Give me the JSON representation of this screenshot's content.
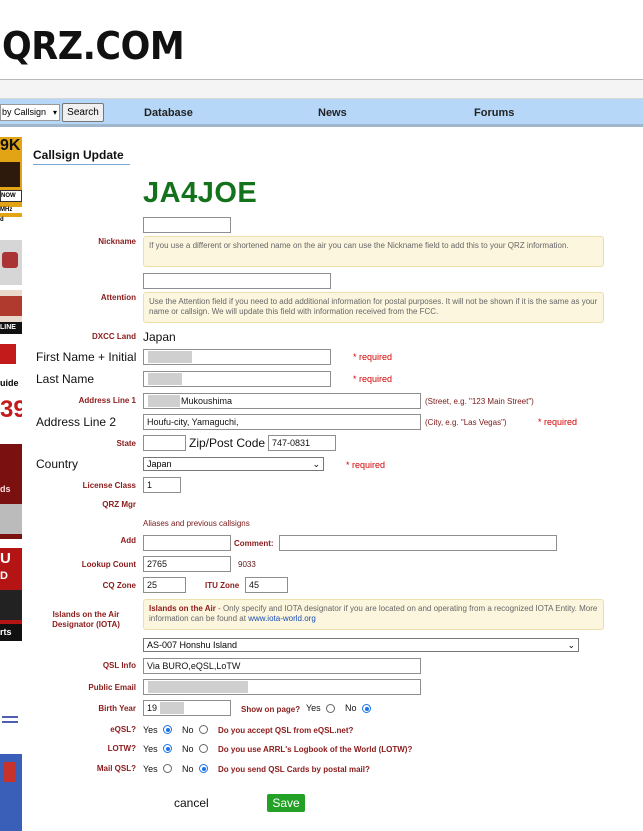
{
  "header": {
    "logo": "QRZ.COM"
  },
  "nav": {
    "search_select": "by Callsign",
    "search_button": "Search",
    "links": [
      "Database",
      "News",
      "Forums"
    ]
  },
  "ads": [
    "9K",
    "NOW",
    "MHz",
    "d",
    "LINE",
    "uide",
    "39",
    "ds",
    "U",
    "D",
    "rts"
  ],
  "page_title": "Callsign Update",
  "callsign": "JA4JOE",
  "fields": {
    "nickname": {
      "label": "Nickname",
      "value": "",
      "note": "If you use a different or shortened name on the air you can use the Nickname field to add this to your QRZ information."
    },
    "attention": {
      "label": "Attention",
      "value": "",
      "note": "Use the Attention field if you need to add additional information for postal purposes. It will not be shown if it is the same as your name or callsign. We will update this field with information received from the FCC."
    },
    "dxcc": {
      "label": "DXCC Land",
      "value": "Japan"
    },
    "first_name": {
      "label": "First Name + Initial",
      "required": "* required"
    },
    "last_name": {
      "label": "Last Name",
      "required": "* required"
    },
    "address1": {
      "label": "Address Line 1",
      "value": "Mukoushima",
      "hint": "(Street, e.g. \"123 Main Street\")"
    },
    "address2": {
      "label": "Address Line 2",
      "value": "Houfu-city, Yamaguchi,",
      "hint": "(City, e.g. \"Las Vegas\")",
      "required": "* required"
    },
    "state": {
      "label": "State",
      "value": ""
    },
    "zip": {
      "label": "Zip/Post Code",
      "value": "747-0831"
    },
    "country": {
      "label": "Country",
      "value": "Japan",
      "required": "* required"
    },
    "license_class": {
      "label": "License Class",
      "value": "1"
    },
    "qrz_mgr": {
      "label": "QRZ Mgr"
    },
    "aliases": {
      "heading": "Aliases and previous callsigns"
    },
    "add": {
      "label": "Add",
      "comment_label": "Comment:"
    },
    "lookup_count": {
      "label": "Lookup Count",
      "value": "2765",
      "extra": "9033"
    },
    "cq_zone": {
      "label": "CQ Zone",
      "value": "25"
    },
    "itu_zone": {
      "label": "ITU Zone",
      "value": "45"
    },
    "iota": {
      "label": "Islands on the Air Designator (IOTA)",
      "note_title": "Islands on the Air",
      "note_body": " - Only specify and IOTA designator if you are located on and operating from a recognized IOTA Entity. More information can be found at ",
      "note_link": "www.iota-world.org",
      "value": "AS-007 Honshu Island"
    },
    "qsl_info": {
      "label": "QSL Info",
      "value": "Via BURO,eQSL,LoTW"
    },
    "public_email": {
      "label": "Public Email",
      "value": ""
    },
    "birth_year": {
      "label": "Birth Year",
      "value": "19",
      "show_label": "Show on page?",
      "yes": "Yes",
      "no": "No",
      "selected": "No"
    },
    "eqsl": {
      "label": "eQSL?",
      "yes": "Yes",
      "no": "No",
      "selected": "Yes",
      "question": "Do you accept QSL from eQSL.net?"
    },
    "lotw": {
      "label": "LOTW?",
      "yes": "Yes",
      "no": "No",
      "selected": "Yes",
      "question": "Do you use ARRL's Logbook of the World (LOTW)?"
    },
    "mail_qsl": {
      "label": "Mail QSL?",
      "yes": "Yes",
      "no": "No",
      "selected": "No",
      "question": "Do you send QSL Cards by postal mail?"
    }
  },
  "actions": {
    "cancel": "cancel",
    "save": "Save"
  },
  "colors": {
    "callsign": "#14721c",
    "label": "#8b1a1a",
    "required": "#d40000",
    "navbar": "#b6d7f8",
    "save": "#23a127"
  }
}
